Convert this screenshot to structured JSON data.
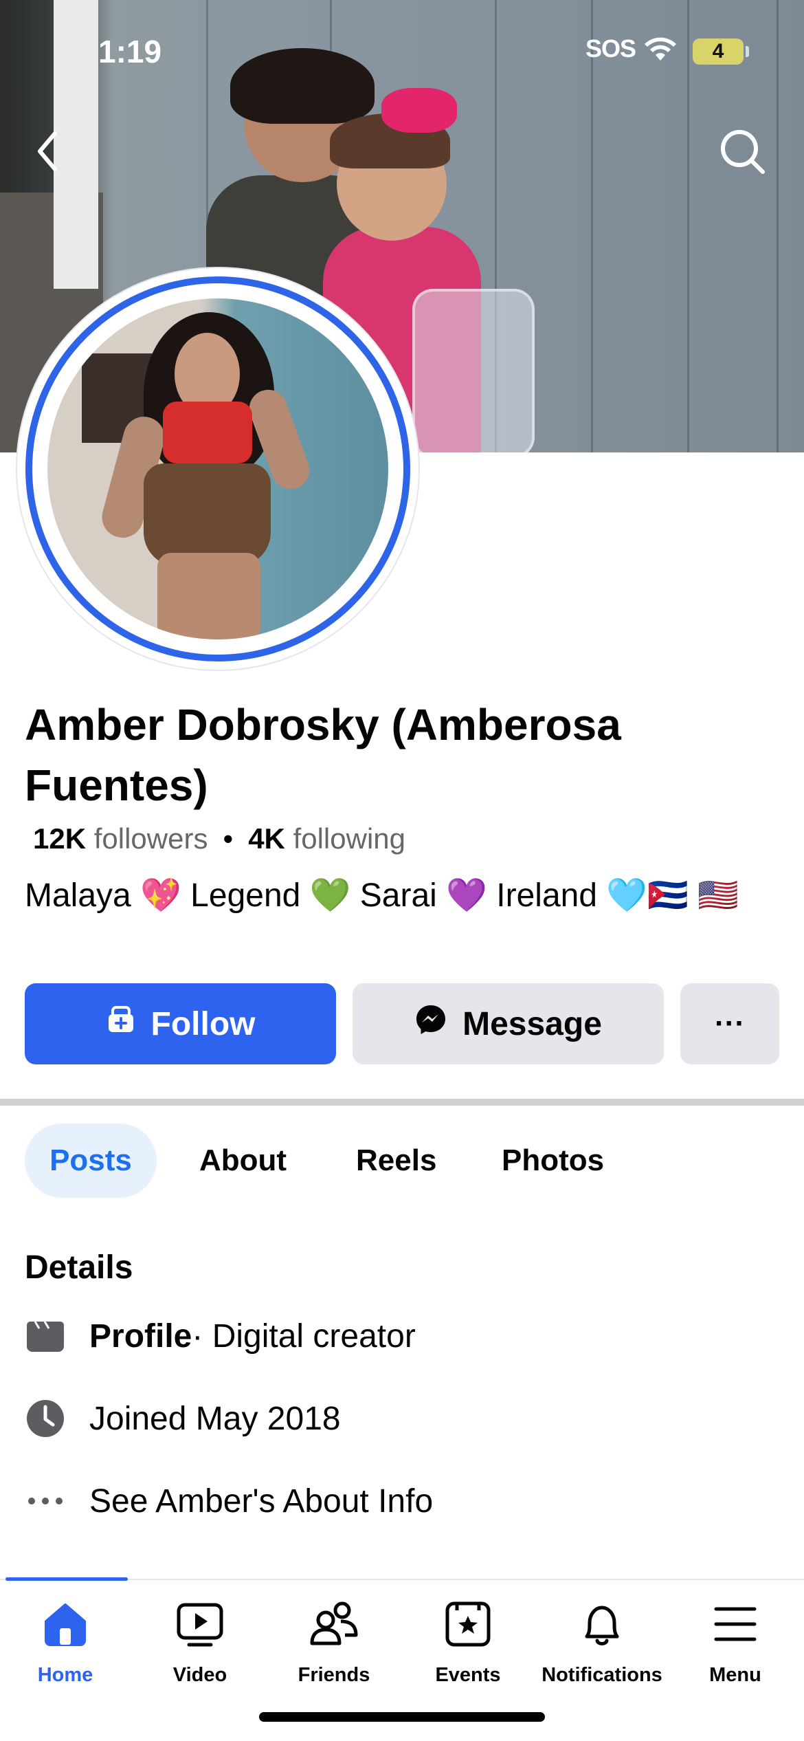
{
  "status_bar": {
    "time": "1:19",
    "signal_text": "SOS",
    "battery_level": "4"
  },
  "top_bar": {
    "back_icon": "chevron-left-icon",
    "search_icon": "search-icon"
  },
  "profile": {
    "name": "Amber Dobrosky (Amberosa Fuentes)",
    "followers_count": "12K",
    "followers_label": "followers",
    "separator": "•",
    "following_count": "4K",
    "following_label": "following",
    "bio": "Malaya 💖 Legend 💚 Sarai 💜 Ireland 🩵🇨🇺 🇺🇸"
  },
  "actions": {
    "follow_label": "Follow",
    "message_label": "Message",
    "more_label": "···"
  },
  "tabs": [
    {
      "label": "Posts",
      "active": true
    },
    {
      "label": "About",
      "active": false
    },
    {
      "label": "Reels",
      "active": false
    },
    {
      "label": "Photos",
      "active": false
    }
  ],
  "details": {
    "title": "Details",
    "profile_label": "Profile",
    "profile_type": " · Digital creator",
    "joined": "Joined May 2018",
    "about_link": "See Amber's About Info"
  },
  "bottom_nav": [
    {
      "label": "Home",
      "icon": "home-icon",
      "active": true
    },
    {
      "label": "Video",
      "icon": "video-icon",
      "active": false
    },
    {
      "label": "Friends",
      "icon": "friends-icon",
      "active": false
    },
    {
      "label": "Events",
      "icon": "events-icon",
      "active": false
    },
    {
      "label": "Notifications",
      "icon": "bell-icon",
      "active": false
    },
    {
      "label": "Menu",
      "icon": "menu-icon",
      "active": false
    }
  ],
  "colors": {
    "accent": "#2e63ef",
    "tab_active_bg": "#e7f1fd",
    "button_secondary": "#e4e6eb"
  }
}
